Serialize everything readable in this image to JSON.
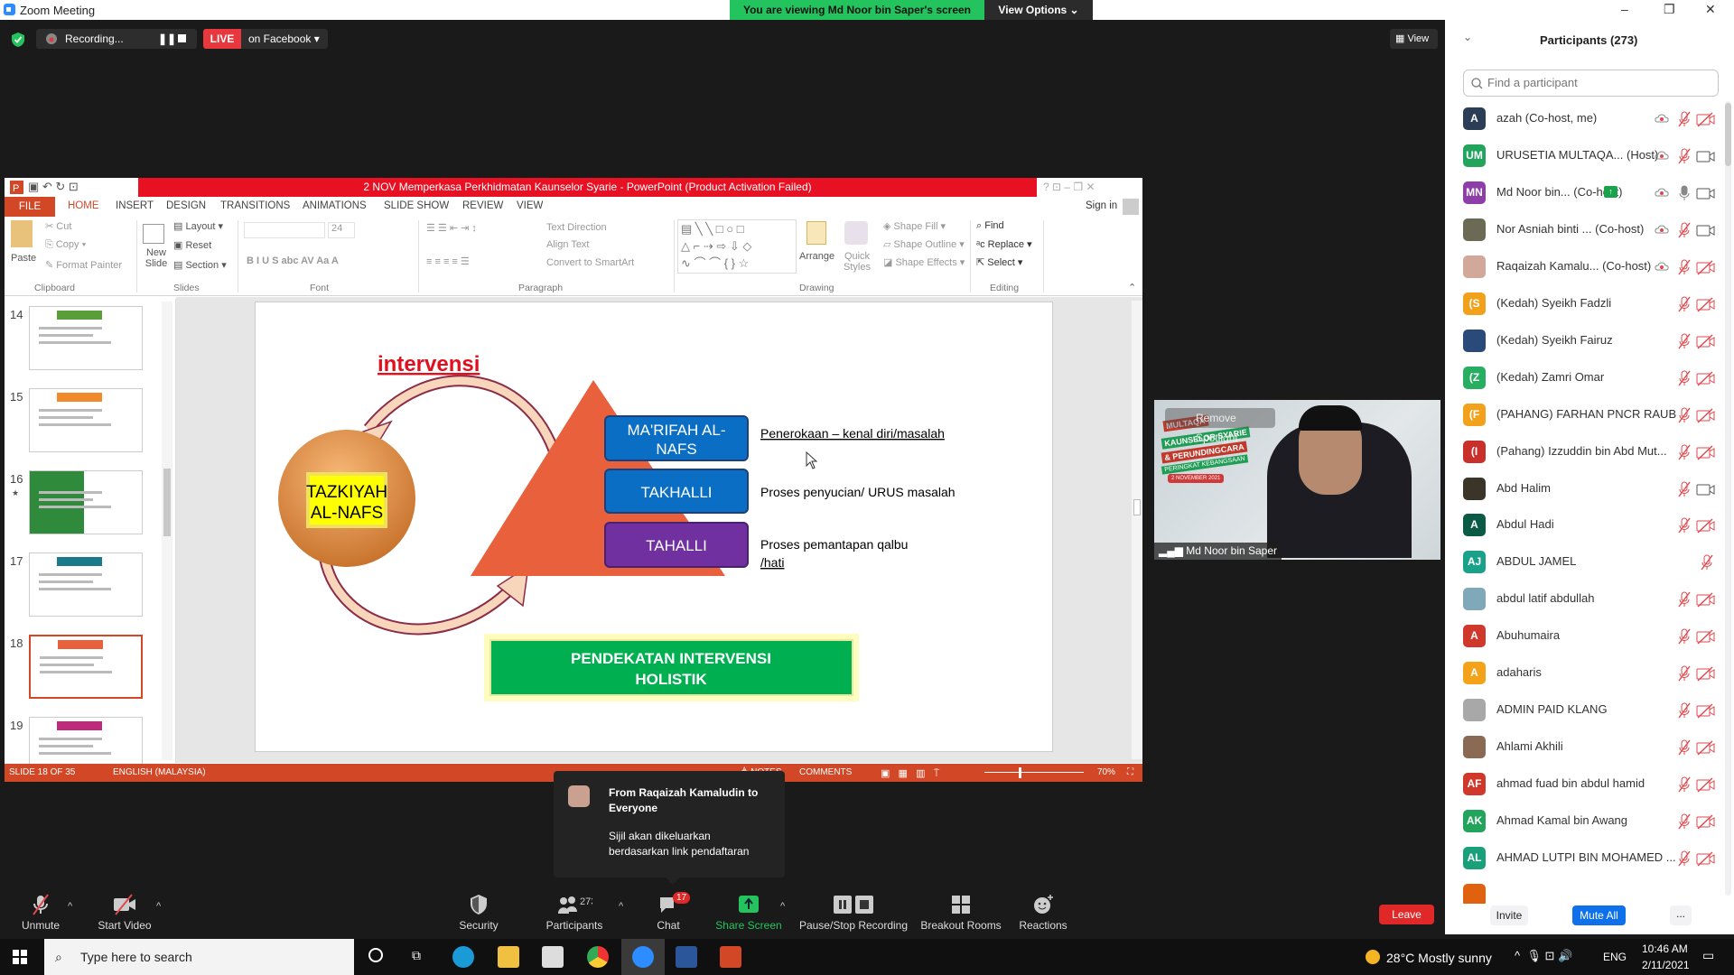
{
  "window": {
    "title": "Zoom Meeting",
    "banner": "You are viewing Md Noor bin Saper's screen",
    "view_options": "View Options ⌄",
    "min": "–",
    "max": "❐",
    "close": "✕"
  },
  "zoom_bar": {
    "recording": "Recording...",
    "live": "LIVE",
    "live_target": "on Facebook ▾",
    "view": "View"
  },
  "ppt": {
    "title": "2 NOV Memperkasa Perkhidmatan Kaunselor Syarie -  PowerPoint (Product Activation Failed)",
    "tabs": [
      "FILE",
      "HOME",
      "INSERT",
      "DESIGN",
      "TRANSITIONS",
      "ANIMATIONS",
      "SLIDE SHOW",
      "REVIEW",
      "VIEW"
    ],
    "sign_in": "Sign in",
    "ribbon": {
      "clipboard": {
        "label": "Clipboard",
        "paste": "Paste",
        "cut": "Cut",
        "copy": "Copy",
        "format_painter": "Format Painter"
      },
      "slides": {
        "label": "Slides",
        "new_slide": "New Slide",
        "layout": "Layout",
        "reset": "Reset",
        "section": "Section"
      },
      "font": {
        "label": "Font",
        "size": "24",
        "buttons": "B  I  U  S  abc  AV  Aa  A"
      },
      "paragraph": {
        "label": "Paragraph",
        "text_direction": "Text Direction",
        "align_text": "Align Text",
        "smartart": "Convert to SmartArt"
      },
      "drawing": {
        "label": "Drawing",
        "arrange": "Arrange",
        "quick_styles": "Quick Styles",
        "shape_fill": "Shape Fill",
        "shape_outline": "Shape Outline",
        "shape_effects": "Shape Effects"
      },
      "editing": {
        "label": "Editing",
        "find": "Find",
        "replace": "Replace",
        "select": "Select"
      }
    },
    "thumbnails": [
      {
        "n": "14"
      },
      {
        "n": "15"
      },
      {
        "n": "16",
        "star": "★"
      },
      {
        "n": "17"
      },
      {
        "n": "18",
        "selected": true
      },
      {
        "n": "19"
      }
    ],
    "slide": {
      "circle": "TAZKIYAH AL-NAFS",
      "circle_l1": "TAZKIYAH",
      "circle_l2": "AL-NAFS",
      "arrow_label": "intervensi",
      "levels": [
        {
          "l1": "MA'RIFAH AL-",
          "l2": "NAFS",
          "desc": "Penerokaan – kenal diri/masalah",
          "color": "#0070c0"
        },
        {
          "l1": "TAKHALLI",
          "desc": "Proses penyucian/ URUS masalah",
          "color": "#0070c0"
        },
        {
          "l1": "TAHALLI",
          "desc": "Proses pemantapan qalbu",
          "desc2": "/hati",
          "color": "#7030a0"
        }
      ],
      "banner_l1": "PENDEKATAN INTERVENSI",
      "banner_l2": "HOLISTIK"
    },
    "status": {
      "slide": "SLIDE 18 OF 35",
      "language": "ENGLISH (MALAYSIA)",
      "notes": "≜ NOTES",
      "comments": "COMMENTS",
      "zoom": "70%"
    }
  },
  "video": {
    "name": "Md Noor bin Saper",
    "remove_spotlight": "Remove Spotlight",
    "bg_l1": "MULTAQA",
    "bg_l2": "KAUNSELOR SYARIE",
    "bg_l3": "& PERUNDINGCARA",
    "bg_l4": "PERINGKAT KEBANGSAAN",
    "bg_date": "2 NOVEMBER 2021"
  },
  "chat": {
    "from": "From Raqaizah Kamaludin to Everyone",
    "message": "Sijil akan dikeluarkan berdasarkan link pendaftaran"
  },
  "toolbar": {
    "unmute": "Unmute",
    "start_video": "Start Video",
    "security": "Security",
    "participants": "Participants",
    "participants_count": "273",
    "chat": "Chat",
    "chat_badge": "17",
    "share": "Share Screen",
    "record": "Pause/Stop Recording",
    "breakout": "Breakout Rooms",
    "reactions": "Reactions",
    "leave": "Leave"
  },
  "panel": {
    "title": "Participants (273)",
    "search_placeholder": "Find a participant",
    "invite": "Invite",
    "mute_all": "Mute All",
    "more": "...",
    "participants": [
      {
        "name": "azah (Co-host, me)",
        "av": "A",
        "color": "#2c3e56",
        "rec": true,
        "mic": "muted",
        "cam": "off"
      },
      {
        "name": "URUSETIA MULTAQA...  (Host)",
        "av": "UM",
        "color": "#22a45d",
        "rec": true,
        "mic": "muted",
        "cam": "on"
      },
      {
        "name": "Md Noor bin...  (Co-host)",
        "av": "MN",
        "color": "#8e3ea8",
        "share": true,
        "rec": true,
        "mic": "on",
        "cam": "on"
      },
      {
        "name": "Nor Asniah binti ...  (Co-host)",
        "photo": "#6b6b55",
        "rec": true,
        "mic": "muted",
        "cam": "on"
      },
      {
        "name": "Raqaizah Kamalu...  (Co-host)",
        "photo": "#d2a89a",
        "rec": true,
        "mic": "muted",
        "cam": "off"
      },
      {
        "name": "(Kedah) Syeikh Fadzli",
        "av": "(S",
        "color": "#f2a11c",
        "mic": "muted",
        "cam": "off"
      },
      {
        "name": "(Kedah) Syeikh Fairuz",
        "photo": "#2a4a7a",
        "mic": "muted",
        "cam": "off"
      },
      {
        "name": "(Kedah) Zamri Omar",
        "av": "(Z",
        "color": "#27ae60",
        "mic": "muted",
        "cam": "off"
      },
      {
        "name": "(PAHANG) FARHAN PNCR RAUB",
        "av": "(F",
        "color": "#f2a11c",
        "mic": "muted",
        "cam": "off"
      },
      {
        "name": "(Pahang) Izzuddin bin Abd Mut...",
        "av": "(I",
        "color": "#c9302c",
        "mic": "muted",
        "cam": "off"
      },
      {
        "name": "Abd Halim",
        "photo": "#3a3528",
        "mic": "muted",
        "cam": "on"
      },
      {
        "name": "Abdul Hadi",
        "av": "A",
        "color": "#0b5a45",
        "mic": "muted",
        "cam": "off"
      },
      {
        "name": "ABDUL JAMEL",
        "av": "AJ",
        "color": "#1aa18a",
        "mic": "muted_right"
      },
      {
        "name": "abdul latif abdullah",
        "photo": "#7fa8b8",
        "mic": "muted",
        "cam": "off"
      },
      {
        "name": "Abuhumaira",
        "av": "A",
        "color": "#d0382b",
        "mic": "muted",
        "cam": "off"
      },
      {
        "name": "adaharis",
        "av": "A",
        "color": "#f5a21b",
        "mic": "muted",
        "cam": "off"
      },
      {
        "name": "ADMIN PAID KLANG",
        "photo": "#a8a8a8",
        "mic": "muted",
        "cam": "off"
      },
      {
        "name": "Ahlami Akhili",
        "photo": "#8a6a55",
        "mic": "muted",
        "cam": "off"
      },
      {
        "name": "ahmad fuad bin abdul hamid",
        "av": "AF",
        "color": "#d0382b",
        "mic": "muted",
        "cam": "off"
      },
      {
        "name": "Ahmad Kamal bin Awang",
        "av": "AK",
        "color": "#22a45d",
        "mic": "muted",
        "cam": "off"
      },
      {
        "name": "AHMAD LUTPI BIN MOHAMED ...",
        "av": "AL",
        "color": "#19a07a",
        "mic": "muted",
        "cam": "off"
      }
    ]
  },
  "taskbar": {
    "search": "Type here to search",
    "weather": "28°C  Mostly sunny",
    "lang": "ENG",
    "time": "10:46 AM",
    "date": "2/11/2021"
  },
  "colors": {
    "zoom_green": "#23c45e",
    "ppt_orange": "#d24726",
    "zoom_blue": "#0e71eb",
    "muted_red": "#e0474c"
  }
}
